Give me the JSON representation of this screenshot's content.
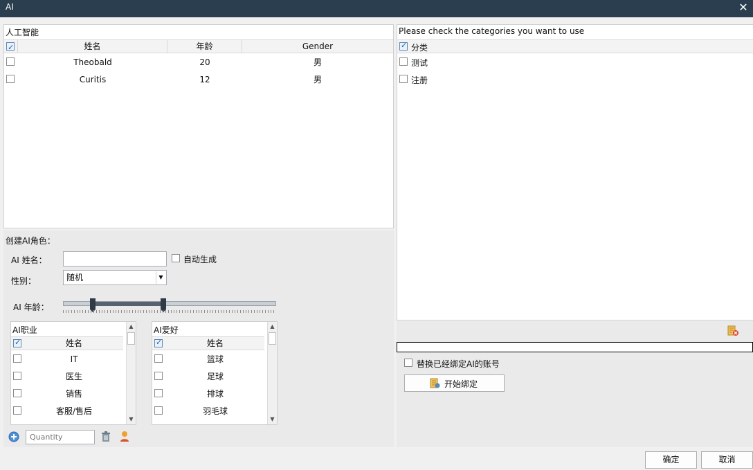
{
  "window": {
    "title": "AI"
  },
  "ai_list": {
    "caption": "人工智能",
    "columns": [
      "姓名",
      "年龄",
      "Gender"
    ],
    "header_checked": true,
    "rows": [
      {
        "name": "Theobald",
        "age": "20",
        "gender": "男",
        "checked": false
      },
      {
        "name": "Curitis",
        "age": "12",
        "gender": "男",
        "checked": false
      }
    ]
  },
  "create": {
    "caption": "创建AI角色：",
    "name_label": "AI 姓名：",
    "name_value": "",
    "auto_label": "自动生成",
    "auto_checked": false,
    "gender_label": "性别：",
    "gender_value": "随机",
    "age_label": "AI 年龄：",
    "age_range_fraction": [
      0.14,
      0.47
    ]
  },
  "profession": {
    "caption": "AI职业",
    "header": "姓名",
    "items": [
      "IT",
      "医生",
      "销售",
      "客服/售后"
    ]
  },
  "hobby": {
    "caption": "AI爱好",
    "header": "姓名",
    "items": [
      "篮球",
      "足球",
      "排球",
      "羽毛球"
    ]
  },
  "bottom_tools": {
    "quantity_placeholder": "Quantity",
    "icons": [
      "add-circle-icon",
      "trash-icon",
      "person-icon"
    ]
  },
  "categories": {
    "caption": "Please check the categories you want to use",
    "header": "分类",
    "header_checked": true,
    "items": [
      "测试",
      "注册"
    ]
  },
  "bind": {
    "replace_label": "替换已经绑定AI的账号",
    "replace_checked": false,
    "start_label": "开始绑定"
  },
  "footer": {
    "ok_label": "确定",
    "cancel_label": "取消"
  },
  "colors": {
    "titlebar": "#2b3e4f",
    "accent": "#1f5fa8"
  }
}
